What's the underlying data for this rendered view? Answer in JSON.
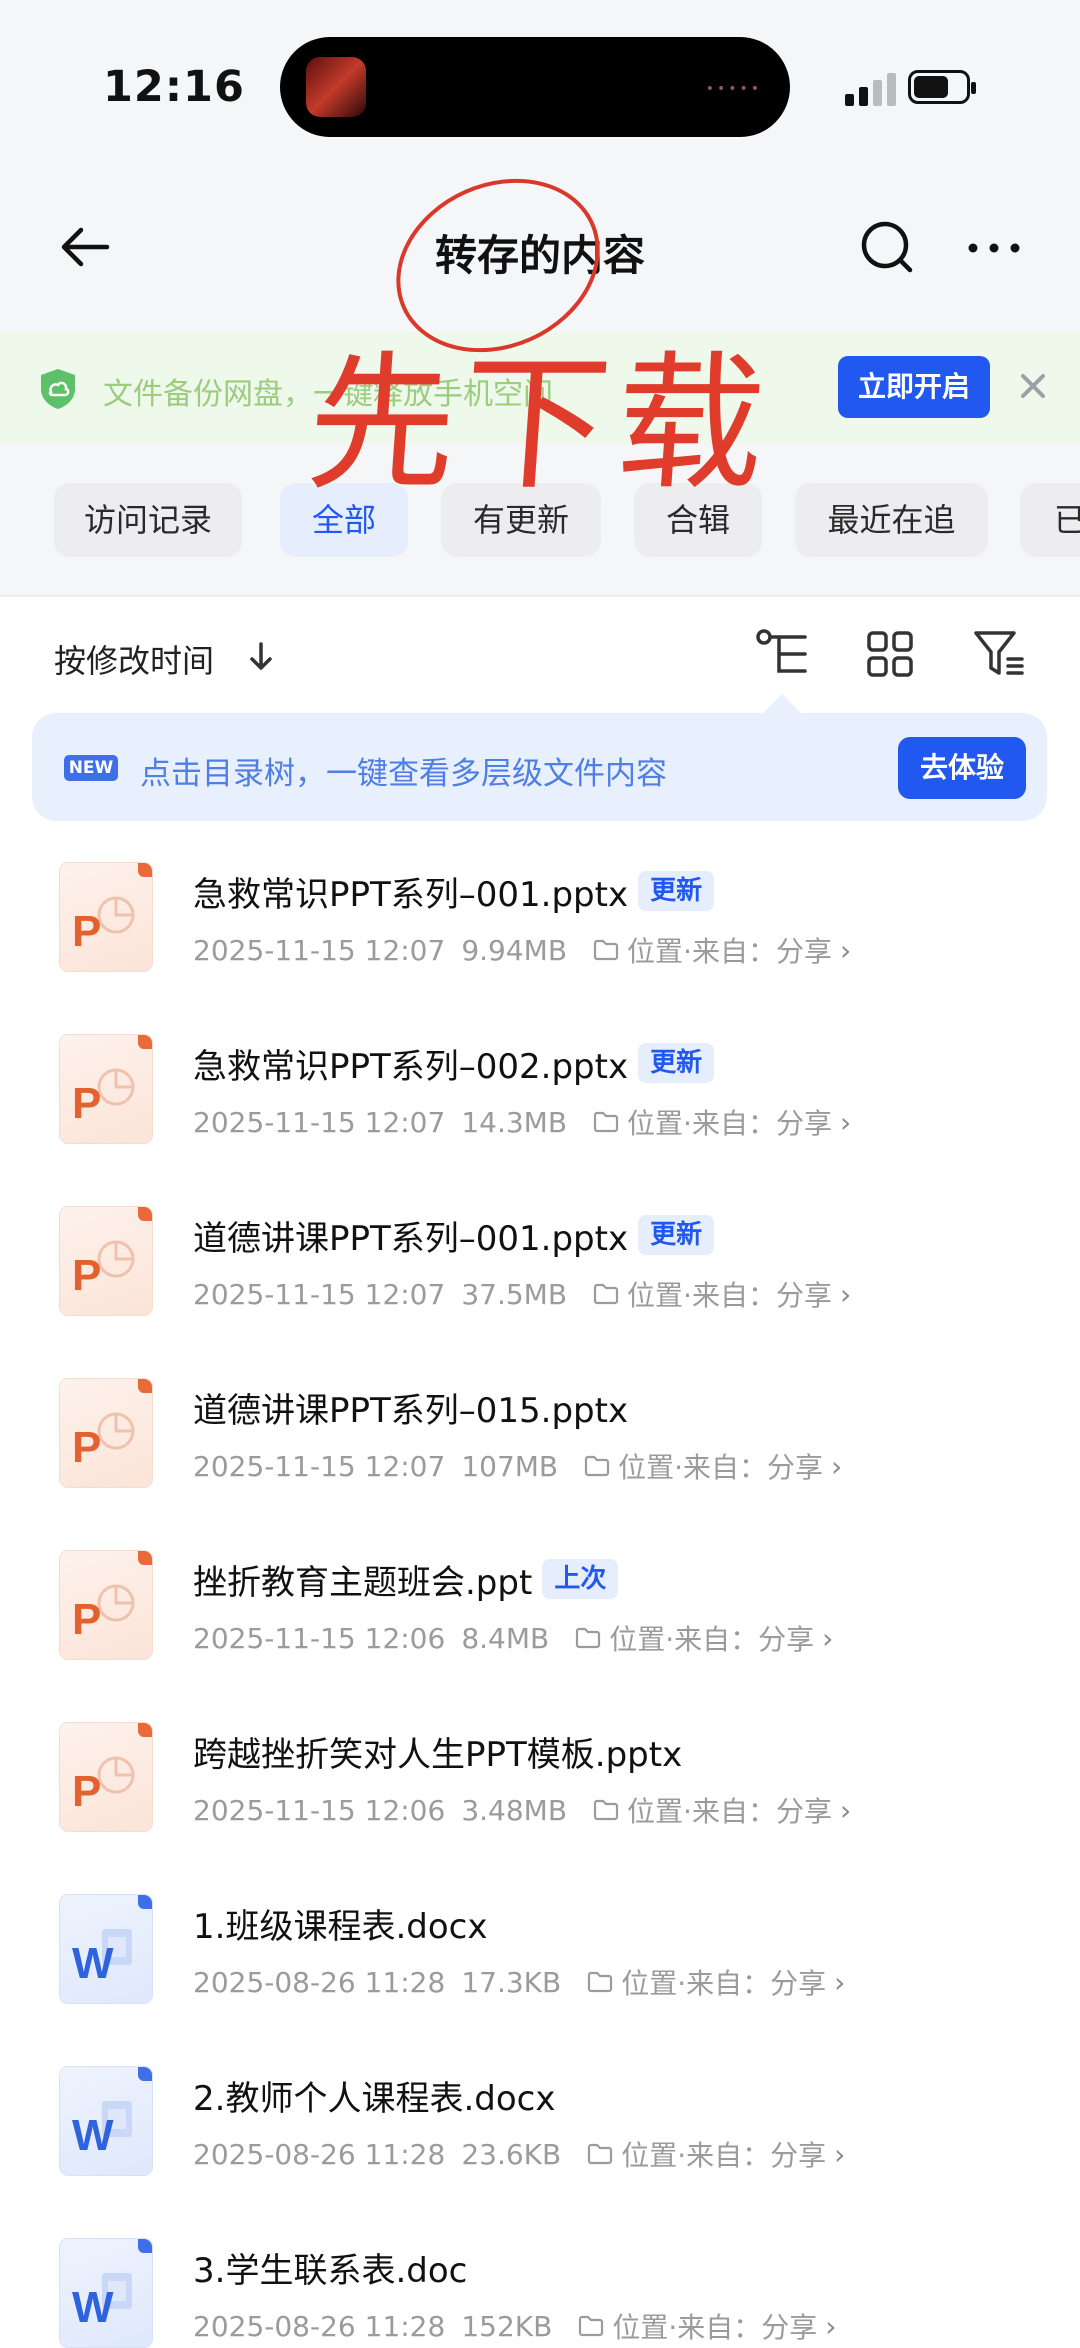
{
  "status_bar": {
    "time": "12:16"
  },
  "header": {
    "title": "转存的内容"
  },
  "annotation": {
    "text": "先下载"
  },
  "backup_banner": {
    "text": "文件备份网盘，一键释放手机空间",
    "button": "立即开启"
  },
  "chips": [
    {
      "label": "访问记录",
      "active": false
    },
    {
      "label": "全部",
      "active": true
    },
    {
      "label": "有更新",
      "active": false
    },
    {
      "label": "合辑",
      "active": false
    },
    {
      "label": "最近在追",
      "active": false
    },
    {
      "label": "已",
      "active": false
    }
  ],
  "sort": {
    "label": "按修改时间"
  },
  "tip": {
    "badge": "NEW",
    "text": "点击目录树，一键查看多层级文件内容",
    "button": "去体验"
  },
  "location_label": "位置·来自：分享",
  "files": [
    {
      "type": "ppt",
      "name": "急救常识PPT系列–001.pptx",
      "badge": "更新",
      "date": "2025-11-15 12:07",
      "size": "9.94MB"
    },
    {
      "type": "ppt",
      "name": "急救常识PPT系列–002.pptx",
      "badge": "更新",
      "date": "2025-11-15 12:07",
      "size": "14.3MB"
    },
    {
      "type": "ppt",
      "name": "道德讲课PPT系列–001.pptx",
      "badge": "更新",
      "date": "2025-11-15 12:07",
      "size": "37.5MB"
    },
    {
      "type": "ppt",
      "name": "道德讲课PPT系列–015.pptx",
      "badge": "",
      "date": "2025-11-15 12:07",
      "size": "107MB"
    },
    {
      "type": "ppt",
      "name": "挫折教育主题班会.ppt",
      "badge": "上次",
      "date": "2025-11-15 12:06",
      "size": "8.4MB"
    },
    {
      "type": "ppt",
      "name": "跨越挫折笑对人生PPT模板.pptx",
      "badge": "",
      "date": "2025-11-15 12:06",
      "size": "3.48MB"
    },
    {
      "type": "doc",
      "name": "1.班级课程表.docx",
      "badge": "",
      "date": "2025-08-26 11:28",
      "size": "17.3KB"
    },
    {
      "type": "doc",
      "name": "2.教师个人课程表.docx",
      "badge": "",
      "date": "2025-08-26 11:28",
      "size": "23.6KB"
    },
    {
      "type": "doc",
      "name": "3.学生联系表.doc",
      "badge": "",
      "date": "2025-08-26 11:28",
      "size": "152KB"
    }
  ],
  "icons": {
    "back": "arrow-left-icon",
    "search": "search-icon",
    "more": "more-icon",
    "shield": "shield-icon",
    "close": "close-icon",
    "sort": "arrow-down-icon",
    "tree": "tree-icon",
    "grid": "grid-icon",
    "filter": "filter-icon",
    "folder": "folder-icon"
  },
  "colors": {
    "accent": "#2158f0",
    "ppt": "#e2612e",
    "word": "#2f62dd",
    "annotation": "#e03c2c",
    "banner_bg": "#eef9ec"
  }
}
